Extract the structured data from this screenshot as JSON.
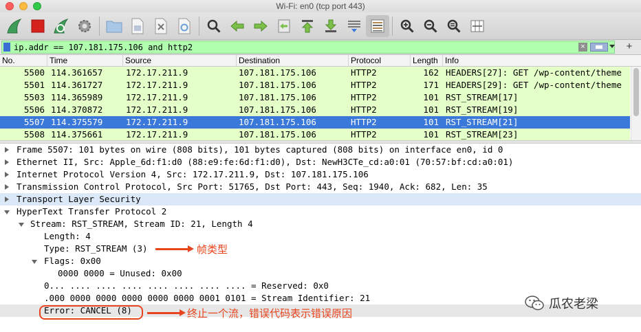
{
  "window": {
    "title": "Wi-Fi: en0 (tcp port 443)"
  },
  "toolbar": {
    "buttons": [
      "shark-fin-start-icon",
      "stop-capture-icon",
      "restart-capture-icon",
      "capture-options-gear-icon",
      "open-file-icon",
      "save-file-icon",
      "close-file-icon",
      "reload-file-icon",
      "find-packet-icon",
      "go-back-icon",
      "go-forward-icon",
      "go-to-packet-icon",
      "go-first-icon",
      "go-last-icon",
      "auto-scroll-icon",
      "colorize-icon",
      "zoom-in-icon",
      "zoom-out-icon",
      "zoom-normal-icon",
      "resize-columns-icon"
    ]
  },
  "filter": {
    "value": "ip.addr == 107.181.175.106 and http2"
  },
  "packet_list": {
    "columns": [
      "No.",
      "Time",
      "Source",
      "Destination",
      "Protocol",
      "Length",
      "Info"
    ],
    "rows": [
      {
        "no": "5500",
        "time": "114.361657",
        "src": "172.17.211.9",
        "dst": "107.181.175.106",
        "proto": "HTTP2",
        "len": "162",
        "info": "HEADERS[27]: GET /wp-content/theme"
      },
      {
        "no": "5501",
        "time": "114.361727",
        "src": "172.17.211.9",
        "dst": "107.181.175.106",
        "proto": "HTTP2",
        "len": "171",
        "info": "HEADERS[29]: GET /wp-content/theme"
      },
      {
        "no": "5503",
        "time": "114.365989",
        "src": "172.17.211.9",
        "dst": "107.181.175.106",
        "proto": "HTTP2",
        "len": "101",
        "info": "RST_STREAM[17]"
      },
      {
        "no": "5506",
        "time": "114.370872",
        "src": "172.17.211.9",
        "dst": "107.181.175.106",
        "proto": "HTTP2",
        "len": "101",
        "info": "RST_STREAM[19]"
      },
      {
        "no": "5507",
        "time": "114.375579",
        "src": "172.17.211.9",
        "dst": "107.181.175.106",
        "proto": "HTTP2",
        "len": "101",
        "info": "RST_STREAM[21]"
      },
      {
        "no": "5508",
        "time": "114.375661",
        "src": "172.17.211.9",
        "dst": "107.181.175.106",
        "proto": "HTTP2",
        "len": "101",
        "info": "RST_STREAM[23]"
      }
    ]
  },
  "details": {
    "lines": [
      "Frame 5507: 101 bytes on wire (808 bits), 101 bytes captured (808 bits) on interface en0, id 0",
      "Ethernet II, Src: Apple_6d:f1:d0 (88:e9:fe:6d:f1:d0), Dst: NewH3CTe_cd:a0:01 (70:57:bf:cd:a0:01)",
      "Internet Protocol Version 4, Src: 172.17.211.9, Dst: 107.181.175.106",
      "Transmission Control Protocol, Src Port: 51765, Dst Port: 443, Seq: 1940, Ack: 682, Len: 35",
      "Transport Layer Security",
      "HyperText Transfer Protocol 2",
      "Stream: RST_STREAM, Stream ID: 21, Length 4",
      "Length: 4",
      "Type: RST_STREAM (3)",
      "Flags: 0x00",
      "0000 0000 = Unused: 0x00",
      "0... .... .... .... .... .... .... .... = Reserved: 0x0",
      ".000 0000 0000 0000 0000 0000 0001 0101 = Stream Identifier: 21",
      "Error: CANCEL (8)"
    ]
  },
  "annotations": {
    "frame_type": "帧类型",
    "error_note": "终止一个流，错误代码表示错误原因"
  },
  "watermark": {
    "text": "瓜农老梁"
  }
}
